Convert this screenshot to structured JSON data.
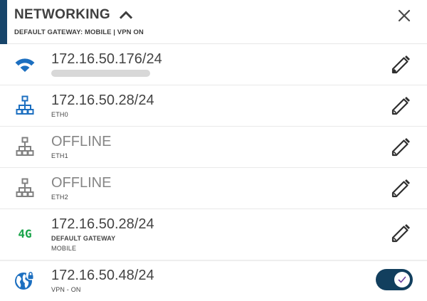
{
  "header": {
    "title": "NETWORKING",
    "subtitle": "DEFAULT GATEWAY: MOBILE | VPN ON",
    "accent_color": "#17456a",
    "collapse_icon": "chevron-up-icon",
    "close_icon": "close-icon"
  },
  "connections": [
    {
      "type": "wifi",
      "icon": "wifi-icon",
      "ip": "172.16.50.176/24",
      "sub": "",
      "status": "online",
      "icon_color": "#1c6fc0"
    },
    {
      "type": "ethernet",
      "icon": "ethernet-network-icon",
      "ip": "172.16.50.28/24",
      "sub": "ETH0",
      "status": "online",
      "icon_color": "#1c6fc0"
    },
    {
      "type": "ethernet",
      "icon": "ethernet-network-icon",
      "ip": "OFFLINE",
      "sub": "ETH1",
      "status": "offline",
      "icon_color": "#808080"
    },
    {
      "type": "ethernet",
      "icon": "ethernet-network-icon",
      "ip": "OFFLINE",
      "sub": "ETH2",
      "status": "offline",
      "icon_color": "#808080"
    },
    {
      "type": "mobile",
      "icon": "4g-icon",
      "icon_text": "4G",
      "ip": "172.16.50.28/24",
      "sub_bold": "DEFAULT GATEWAY",
      "sub": "MOBILE",
      "status": "online",
      "icon_color": "#1aa44a"
    },
    {
      "type": "vpn",
      "icon": "globe-lock-icon",
      "ip": "172.16.50.48/24",
      "sub": "VPN - ON",
      "status": "online",
      "icon_color": "#1c6fc0",
      "toggle_on": true,
      "toggle_color": "#123f5e",
      "check_color": "#6a3fa0"
    }
  ],
  "edit_icon": "pencil-icon"
}
